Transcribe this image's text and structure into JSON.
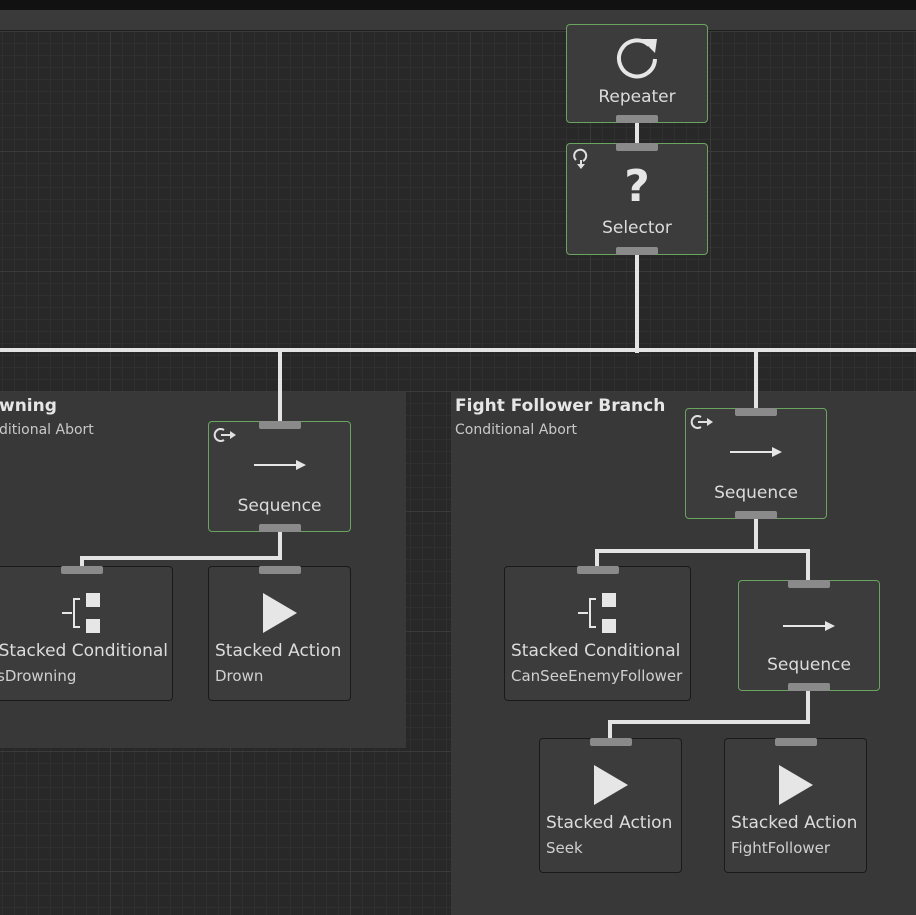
{
  "groups": {
    "left": {
      "title": "wning",
      "subtitle": "ditional Abort"
    },
    "right": {
      "title": "Fight Follower Branch",
      "subtitle": "Conditional Abort"
    }
  },
  "nodes": {
    "repeater": {
      "name": "Repeater",
      "icon": "repeat-icon"
    },
    "selector": {
      "name": "Selector",
      "icon": "question-mark-icon",
      "badge": "selector-abort-icon"
    },
    "sequence_left": {
      "name": "Sequence",
      "icon": "arrow-right-icon",
      "badge": "conditional-abort-icon"
    },
    "conditional_left": {
      "name": "Stacked Conditional",
      "task": "sDrowning",
      "icon": "stacked-conditional-icon"
    },
    "action_drown": {
      "name": "Stacked Action",
      "task": "Drown",
      "icon": "play-icon"
    },
    "sequence_right": {
      "name": "Sequence",
      "icon": "arrow-right-icon",
      "badge": "conditional-abort-icon"
    },
    "conditional_right": {
      "name": "Stacked Conditional",
      "task": "CanSeeEnemyFollower",
      "icon": "stacked-conditional-icon"
    },
    "sequence_inner": {
      "name": "Sequence",
      "icon": "arrow-right-icon"
    },
    "action_seek": {
      "name": "Stacked Action",
      "task": "Seek",
      "icon": "play-icon"
    },
    "action_fight": {
      "name": "Stacked Action",
      "task": "FightFollower",
      "icon": "play-icon"
    }
  },
  "colors": {
    "active_border": "#6aa460",
    "wire": "#e4e4e4",
    "node_bg": "#3c3c3c",
    "group_bg": "#383838"
  }
}
